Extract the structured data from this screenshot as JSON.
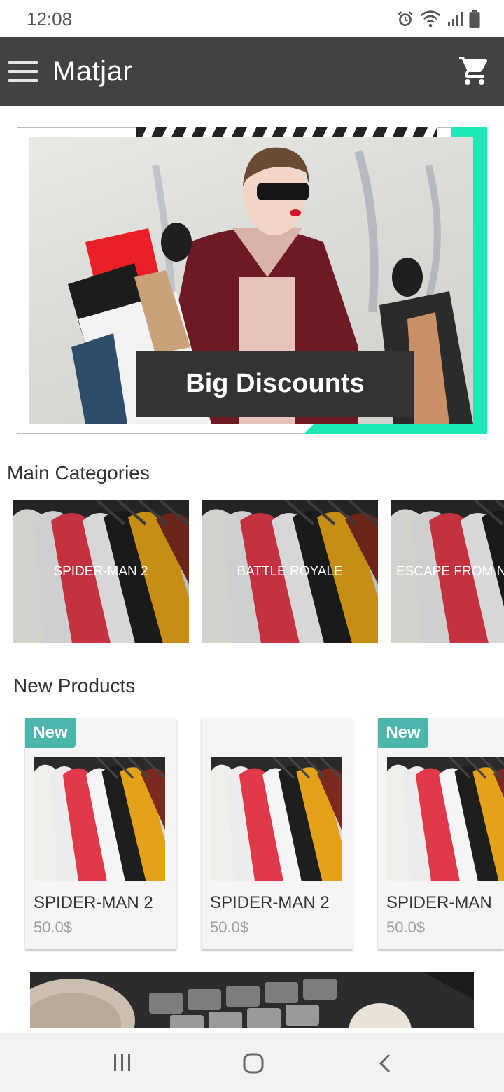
{
  "status_bar": {
    "time": "12:08"
  },
  "app_bar": {
    "title": "Matjar"
  },
  "banner": {
    "caption": "Big Discounts",
    "accent_color": "#1de9b6"
  },
  "main_categories": {
    "title": "Main Categories",
    "items": [
      {
        "label": "SPIDER-MAN 2"
      },
      {
        "label": "BATTLE ROYALE"
      },
      {
        "label": "ESCAPE FROM N"
      }
    ]
  },
  "new_products": {
    "title": "New Products",
    "items": [
      {
        "badge": "New",
        "name": "SPIDER-MAN 2",
        "price": "50.0$"
      },
      {
        "badge": "",
        "name": "SPIDER-MAN 2",
        "price": "50.0$"
      },
      {
        "badge": "New",
        "name": "SPIDER-MAN",
        "price": "50.0$"
      }
    ]
  },
  "colors": {
    "app_bar": "#424242",
    "badge": "#4db6ac",
    "accent": "#1de9b6"
  }
}
